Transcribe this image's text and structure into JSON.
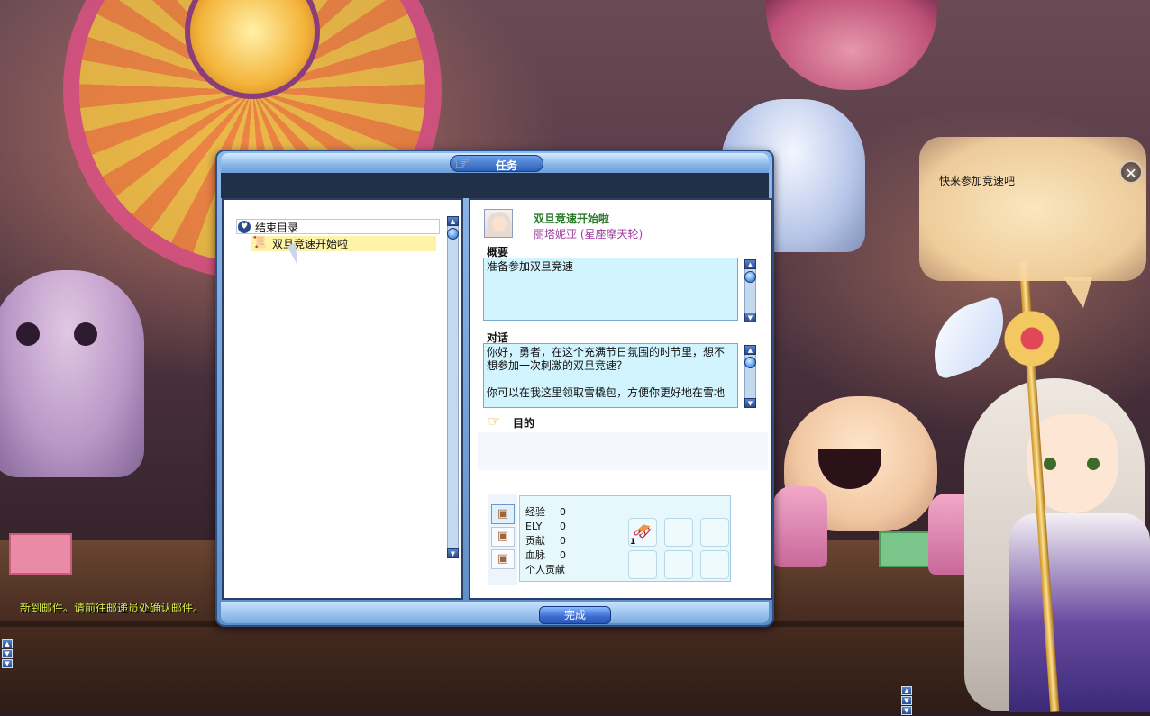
{
  "dialog": {
    "title": "任务",
    "complete_label": "完成"
  },
  "quest_tree": {
    "header_label": "结束目录",
    "items": [
      {
        "label": "双旦竞速开始啦"
      }
    ]
  },
  "quest_detail": {
    "title": "双旦竞速开始啦",
    "npc_name": "丽塔妮亚 (星座摩天轮)",
    "summary_label": "概要",
    "summary_text": "准备参加双旦竞速",
    "dialog_label": "对话",
    "dialog_line1": "你好，勇者，在这个充满节日氛围的时节里，想不想参加一次刺激的双旦竞速？",
    "dialog_line2": "你可以在我这里领取雪橇包，方便你更好地在雪地",
    "goal_label": "目的"
  },
  "rewards": {
    "rows": [
      {
        "label": "经验",
        "value": "0"
      },
      {
        "label": "ELY",
        "value": "0"
      },
      {
        "label": "贡献",
        "value": "0"
      },
      {
        "label": "血脉",
        "value": "0"
      },
      {
        "label": "个人贡献",
        "value": ""
      }
    ],
    "item_slot_qty": "1"
  },
  "npc_bubble": {
    "text": "快来参加竞速吧"
  },
  "system_notice": "新到邮件。请前往邮递员处确认邮件。",
  "colors": {
    "quest_title": "#2c7a2c",
    "npc_name": "#a03aa0",
    "notice": "#d8f04a",
    "dialog_frame": "#5e8ec8"
  }
}
